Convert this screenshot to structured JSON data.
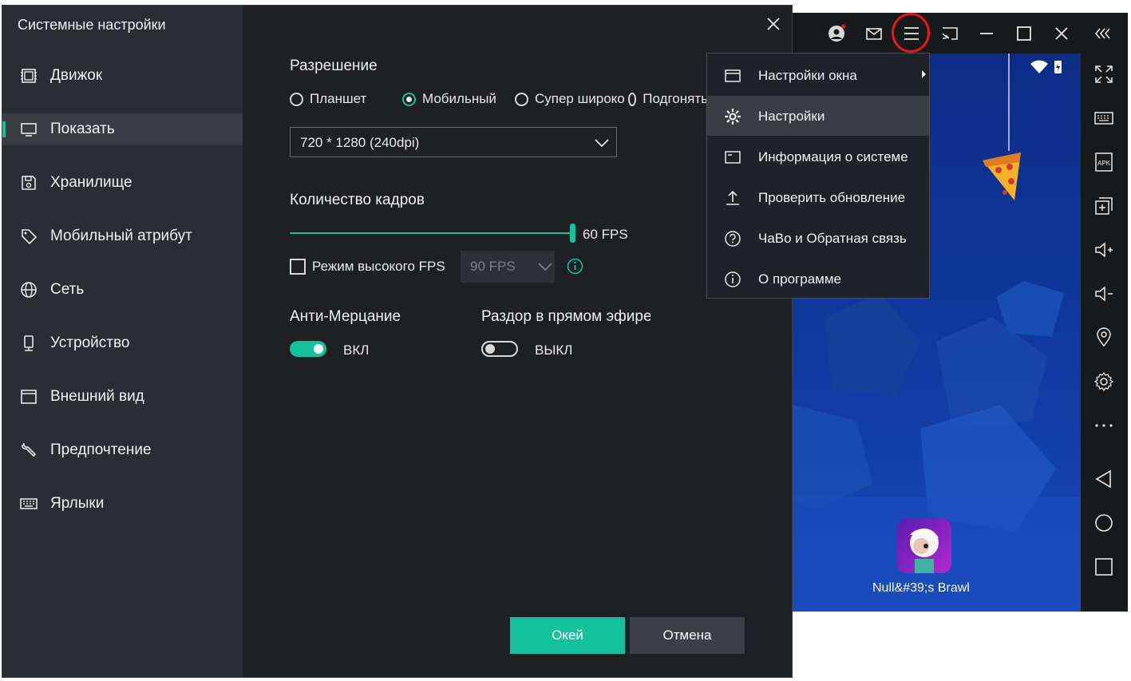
{
  "dialog": {
    "title": "Системные настройки",
    "nav": [
      {
        "label": "Движок",
        "icon": "chip-icon"
      },
      {
        "label": "Показать",
        "icon": "monitor-icon"
      },
      {
        "label": "Хранилище",
        "icon": "floppy-icon"
      },
      {
        "label": "Мобильный атрибут",
        "icon": "tag-icon"
      },
      {
        "label": "Сеть",
        "icon": "globe-icon"
      },
      {
        "label": "Устройство",
        "icon": "phone-icon"
      },
      {
        "label": "Внешний вид",
        "icon": "window-icon"
      },
      {
        "label": "Предпочтение",
        "icon": "wrench-icon"
      },
      {
        "label": "Ярлыки",
        "icon": "keyboard-icon"
      }
    ],
    "active_nav": "Показать",
    "resolution": {
      "heading": "Разрешение",
      "options": [
        "Планшет",
        "Мобильный",
        "Супер широко",
        "Подгонять"
      ],
      "selected": "Мобильный",
      "value": "720 * 1280 (240dpi)"
    },
    "framerate": {
      "heading": "Количество кадров",
      "value_label": "60 FPS",
      "high_fps_label": "Режим высокого FPS",
      "high_fps_checked": false,
      "high_fps_value": "90 FPS"
    },
    "anti_flicker": {
      "heading": "Анти-Мерцание",
      "state": "ВКЛ",
      "on": true
    },
    "discord": {
      "heading": "Раздор в прямом эфире",
      "state": "ВЫКЛ",
      "on": false
    },
    "buttons": {
      "ok": "Окей",
      "cancel": "Отмена"
    }
  },
  "menu": {
    "items": [
      {
        "label": "Настройки окна",
        "icon": "window-icon",
        "submenu": true
      },
      {
        "label": "Настройки",
        "icon": "gear-icon",
        "highlighted": true
      },
      {
        "label": "Информация о системе",
        "icon": "window-icon"
      },
      {
        "label": "Проверить обновление",
        "icon": "upload-icon"
      },
      {
        "label": "ЧаВо и Обратная связь",
        "icon": "help-icon"
      },
      {
        "label": "О программе",
        "icon": "info-icon"
      }
    ]
  },
  "emulator": {
    "app_label": "Null&#39;s Brawl",
    "top_icons": [
      "user-icon",
      "mail-icon",
      "menu-icon",
      "screen-cast-icon",
      "minimize-icon",
      "maximize-icon",
      "close-icon",
      "collapse-icon"
    ],
    "side_icons": [
      "fullscreen-icon",
      "keyboard-icon",
      "apk-icon",
      "add-window-icon",
      "volume-up-icon",
      "volume-down-icon",
      "location-icon",
      "gear-icon",
      "more-icon",
      "back-icon",
      "home-icon",
      "recents-icon"
    ]
  },
  "colors": {
    "accent": "#14c19d",
    "highlight_ring": "#e8161c",
    "dialog_bg": "#1e2023",
    "sidebar_bg": "#2a2d31"
  }
}
